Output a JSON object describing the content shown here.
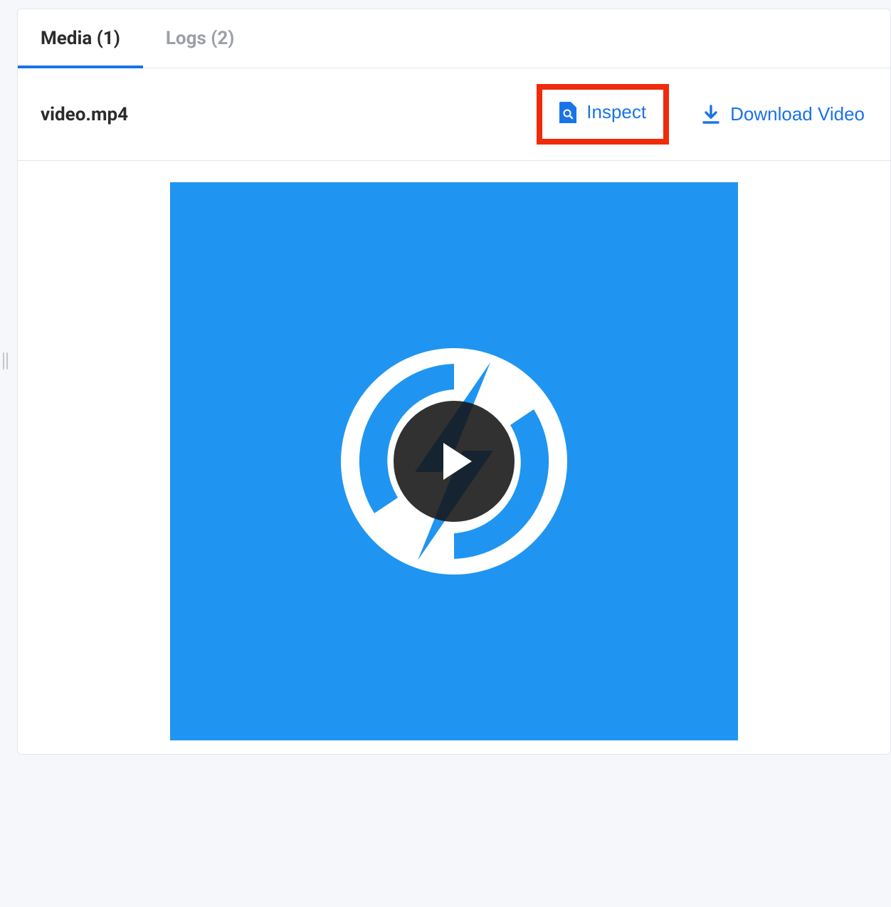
{
  "tabs": [
    {
      "label": "Media (1)",
      "active": true
    },
    {
      "label": "Logs (2)",
      "active": false
    }
  ],
  "file": {
    "name": "video.mp4"
  },
  "actions": {
    "inspect": "Inspect",
    "download": "Download Video"
  },
  "colors": {
    "accent": "#1a73e8",
    "highlight": "#ef2b0a",
    "video_bg": "#1f95f1"
  }
}
